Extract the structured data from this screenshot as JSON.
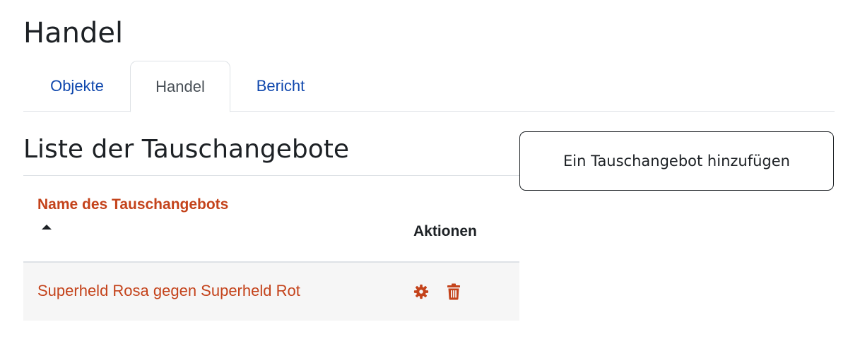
{
  "page": {
    "title": "Handel"
  },
  "tabs": [
    {
      "label": "Objekte",
      "active": false
    },
    {
      "label": "Handel",
      "active": true
    },
    {
      "label": "Bericht",
      "active": false
    }
  ],
  "section": {
    "title": "Liste der Tauschangebote",
    "add_button_label": "Ein Tauschangebot hinzufügen"
  },
  "table": {
    "columns": {
      "name": "Name des Tauschangebots",
      "actions": "Aktionen"
    },
    "sort": {
      "column": "name",
      "direction": "ascending"
    },
    "rows": [
      {
        "name": "Superheld Rosa gegen Superheld Rot",
        "actions": [
          {
            "icon": "gear-icon"
          },
          {
            "icon": "trash-icon"
          }
        ]
      }
    ]
  },
  "colors": {
    "link_accent": "#c4431b",
    "tab_link": "#0f47ad",
    "text": "#1d2125",
    "row_background": "#f6f6f6"
  }
}
